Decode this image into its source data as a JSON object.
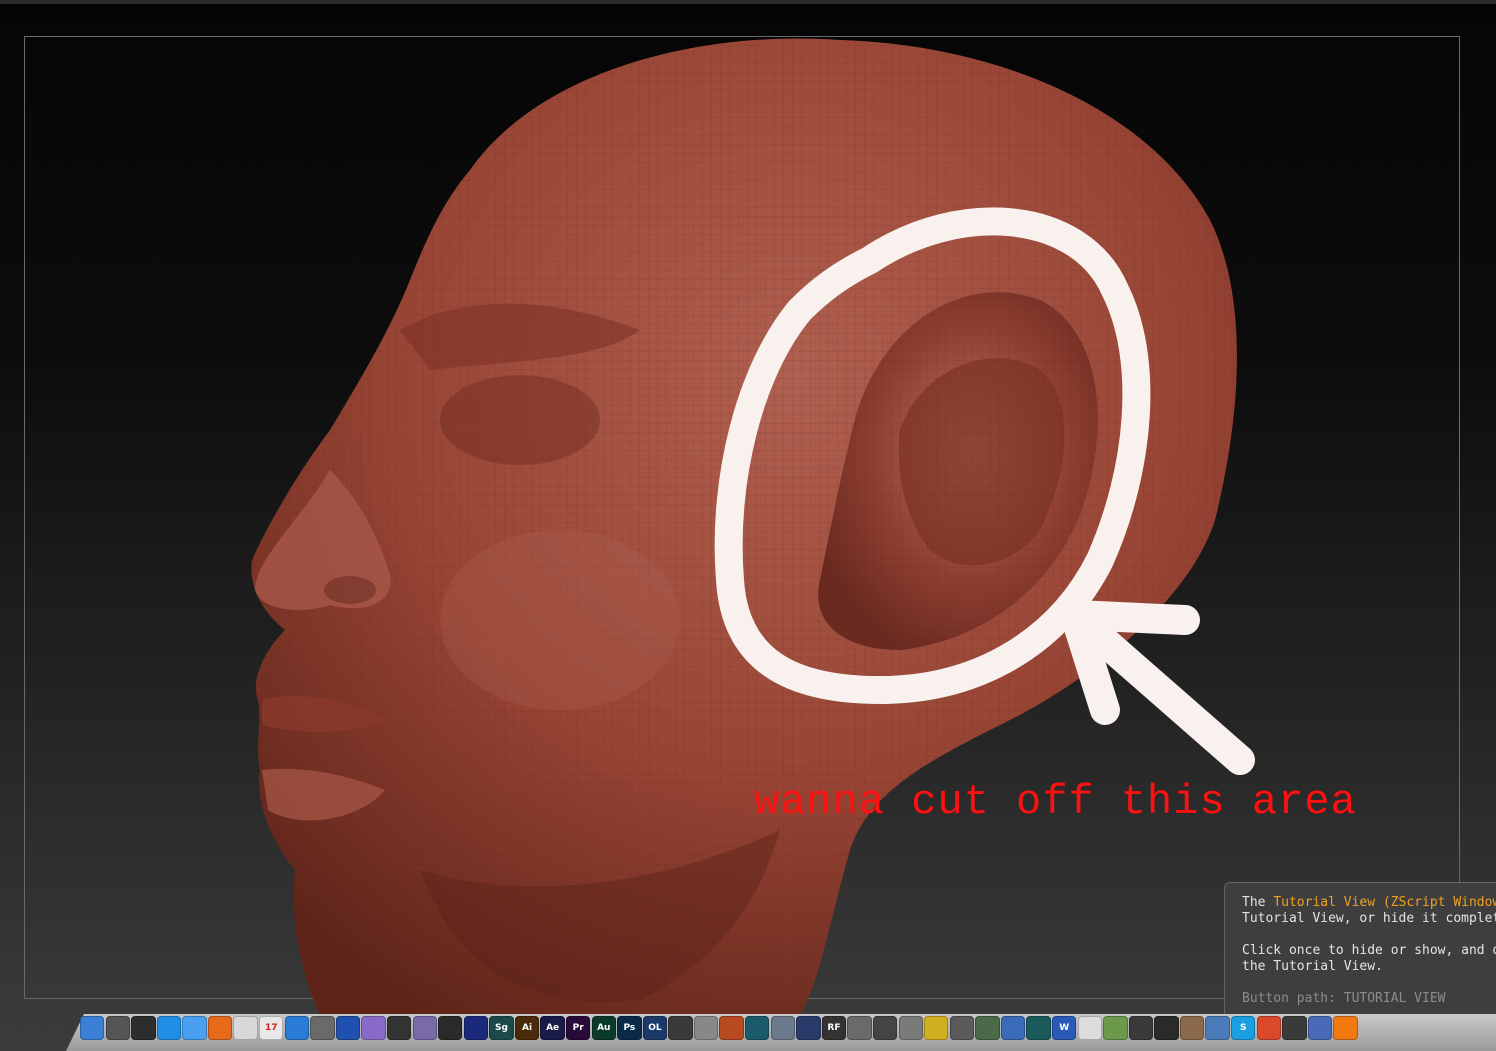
{
  "annotation": "wanna cut off this area",
  "tooltip": {
    "line1_prefix": "The ",
    "line1_highlight": "Tutorial View (ZScript Window)",
    "line2": "Tutorial View, or hide it completely",
    "line3": "Click once to hide or show, and drag",
    "line4": "the Tutorial View.",
    "line5": "Button path: TUTORIAL VIEW"
  },
  "colors": {
    "sculpt_clay": "#9a4436",
    "annotation_red": "#ff1010",
    "tooltip_highlight": "#f0a020",
    "circle_stroke": "#f8f1ee"
  },
  "dock": {
    "icons": [
      {
        "name": "finder-icon",
        "label": "",
        "color": "#3b7fd6"
      },
      {
        "name": "launchpad-icon",
        "label": "",
        "color": "#555"
      },
      {
        "name": "dashboard-icon",
        "label": "",
        "color": "#2d2d2d"
      },
      {
        "name": "app-store-icon",
        "label": "",
        "color": "#1e8ee6"
      },
      {
        "name": "messages-icon",
        "label": "",
        "color": "#4aa0f0"
      },
      {
        "name": "firefox-icon",
        "label": "",
        "color": "#e66a1a"
      },
      {
        "name": "address-book-icon",
        "label": "",
        "color": "#d8d8d8"
      },
      {
        "name": "ical-icon",
        "label": "17",
        "color": "#e8e8e8"
      },
      {
        "name": "itunes-icon",
        "label": "",
        "color": "#2a7ad8"
      },
      {
        "name": "preview-icon",
        "label": "",
        "color": "#6a6a6a"
      },
      {
        "name": "network-icon",
        "label": "",
        "color": "#2050b0"
      },
      {
        "name": "photo-app-icon",
        "label": "",
        "color": "#8a6ac8"
      },
      {
        "name": "clapper-icon",
        "label": "",
        "color": "#333"
      },
      {
        "name": "safari-icon",
        "label": "",
        "color": "#7a6aa8"
      },
      {
        "name": "device-icon",
        "label": "",
        "color": "#2a2a2a"
      },
      {
        "name": "dvd-icon",
        "label": "",
        "color": "#1a2a7a"
      },
      {
        "name": "speedgrade-icon",
        "label": "Sg",
        "color": "#1c4a48"
      },
      {
        "name": "illustrator-icon",
        "label": "Ai",
        "color": "#4a2a08"
      },
      {
        "name": "after-effects-icon",
        "label": "Ae",
        "color": "#1a1a4a"
      },
      {
        "name": "premiere-icon",
        "label": "Pr",
        "color": "#2a0a3a"
      },
      {
        "name": "audition-icon",
        "label": "Au",
        "color": "#0a3a2a"
      },
      {
        "name": "photoshop-icon",
        "label": "Ps",
        "color": "#0a2a4a"
      },
      {
        "name": "onlocation-icon",
        "label": "OL",
        "color": "#1a3a6a"
      },
      {
        "name": "sbo-icon",
        "label": "",
        "color": "#3a3a3a"
      },
      {
        "name": "tool-icon",
        "label": "",
        "color": "#888"
      },
      {
        "name": "mudbox-icon",
        "label": "",
        "color": "#b84a20"
      },
      {
        "name": "maya-icon",
        "label": "",
        "color": "#1a5a6a"
      },
      {
        "name": "motion-icon",
        "label": "",
        "color": "#6a7a8a"
      },
      {
        "name": "cinema4d-icon",
        "label": "",
        "color": "#2a3a6a"
      },
      {
        "name": "realflow-icon",
        "label": "RF",
        "color": "#333"
      },
      {
        "name": "brush-icon",
        "label": "",
        "color": "#6a6a6a"
      },
      {
        "name": "zbrush-icon",
        "label": "",
        "color": "#444"
      },
      {
        "name": "utility-icon",
        "label": "",
        "color": "#7a7a7a"
      },
      {
        "name": "radiation-icon",
        "label": "",
        "color": "#d0b020"
      },
      {
        "name": "robot-icon",
        "label": "",
        "color": "#5a5a5a"
      },
      {
        "name": "pencil-icon",
        "label": "",
        "color": "#4a6a4a"
      },
      {
        "name": "capsule-icon",
        "label": "",
        "color": "#3a6ab8"
      },
      {
        "name": "mountain-icon",
        "label": "",
        "color": "#1a5a5a"
      },
      {
        "name": "word-icon",
        "label": "W",
        "color": "#2a5ab8"
      },
      {
        "name": "document-icon",
        "label": "",
        "color": "#dcdcdc"
      },
      {
        "name": "leaf-icon",
        "label": "",
        "color": "#6a9a4a"
      },
      {
        "name": "tray-icon",
        "label": "",
        "color": "#3a3a3a"
      },
      {
        "name": "film-icon",
        "label": "",
        "color": "#2a2a2a"
      },
      {
        "name": "gear-icon",
        "label": "",
        "color": "#8a6a4a"
      },
      {
        "name": "sparkle-icon",
        "label": "",
        "color": "#4a7ab8"
      },
      {
        "name": "skype-icon",
        "label": "S",
        "color": "#1aa0e0"
      },
      {
        "name": "chrome-icon",
        "label": "",
        "color": "#d84a2a"
      },
      {
        "name": "record-icon",
        "label": "",
        "color": "#3a3a3a"
      },
      {
        "name": "monitor-icon",
        "label": "",
        "color": "#4a6ab8"
      },
      {
        "name": "vlc-icon",
        "label": "",
        "color": "#f07a10"
      }
    ]
  }
}
